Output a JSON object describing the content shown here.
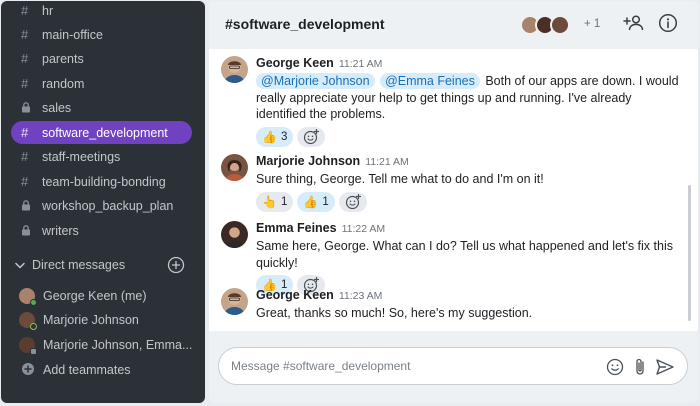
{
  "sidebar": {
    "channels": [
      {
        "name": "hr",
        "icon": "hash-icon",
        "active": false
      },
      {
        "name": "main-office",
        "icon": "hash-icon",
        "active": false
      },
      {
        "name": "parents",
        "icon": "hash-icon",
        "active": false
      },
      {
        "name": "random",
        "icon": "hash-icon",
        "active": false
      },
      {
        "name": "sales",
        "icon": "lock-icon",
        "active": false
      },
      {
        "name": "software_development",
        "icon": "hash-icon",
        "active": true
      },
      {
        "name": "staff-meetings",
        "icon": "hash-icon",
        "active": false
      },
      {
        "name": "team-building-bonding",
        "icon": "hash-icon",
        "active": false
      },
      {
        "name": "workshop_backup_plan",
        "icon": "lock-icon",
        "active": false
      },
      {
        "name": "writers",
        "icon": "lock-icon",
        "active": false
      }
    ],
    "direct_messages": {
      "label": "Direct messages",
      "items": [
        {
          "name": "George Keen (me)",
          "status": "online"
        },
        {
          "name": "Marjorie Johnson",
          "status": "away"
        },
        {
          "name": "Marjorie Johnson, Emma...",
          "status": "group"
        }
      ]
    },
    "add_teammates": "Add teammates"
  },
  "header": {
    "title": "#software_development",
    "member_count": "+ 1"
  },
  "messages": [
    {
      "author": "George Keen",
      "time": "11:21 AM",
      "mentions": [
        "@Marjorie Johnson",
        "@Emma Feines"
      ],
      "text": "Both of our apps are down. I would really appreciate your help to get things up and running. I've already identified the problems.",
      "reactions": [
        {
          "emoji": "👍",
          "count": "3",
          "mine": true
        }
      ]
    },
    {
      "author": "Marjorie Johnson",
      "time": "11:21 AM",
      "text": "Sure thing, George. Tell me what to do and I'm on it!",
      "reactions": [
        {
          "emoji": "👆",
          "count": "1",
          "mine": false
        },
        {
          "emoji": "👍",
          "count": "1",
          "mine": true
        }
      ]
    },
    {
      "author": "Emma Feines",
      "time": "11:22 AM",
      "text": "Same here, George. What can I do? Tell us what happened and let's fix this quickly!",
      "reactions": [
        {
          "emoji": "👍",
          "count": "1",
          "mine": true
        }
      ]
    },
    {
      "author": "George Keen",
      "time": "11:23 AM",
      "text": "Great, thanks so much! So, here's my suggestion.",
      "reactions": []
    }
  ],
  "composer": {
    "placeholder": "Message #software_development"
  },
  "colors": {
    "sidebar_bg": "#2b3137",
    "active_channel": "#6f42c1",
    "mention_bg": "#d7ecfb",
    "online": "#4caf50",
    "away": "#8bc34a"
  }
}
